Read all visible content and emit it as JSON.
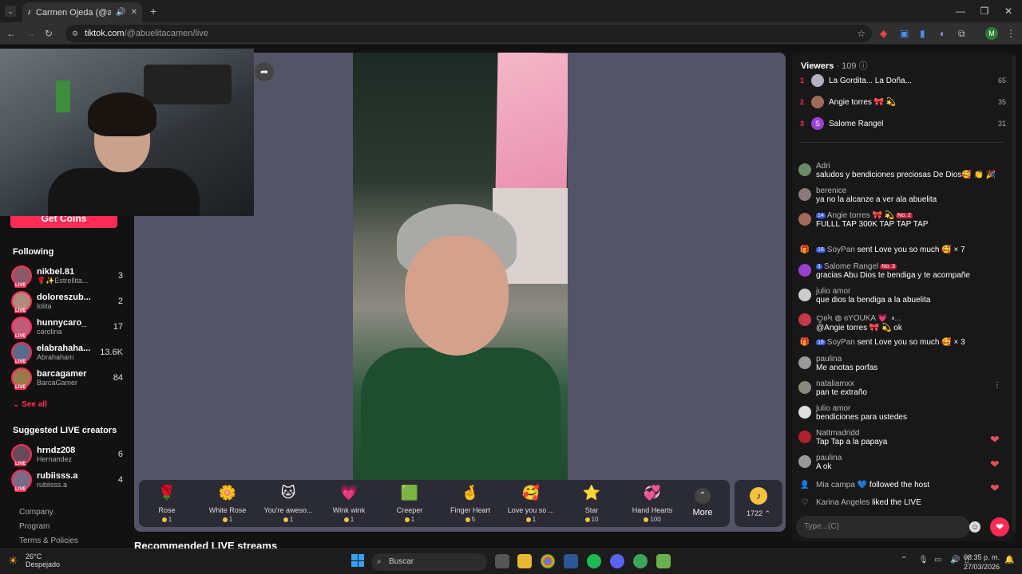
{
  "browser": {
    "tab_title": "Carmen Ojeda (@abuelitac",
    "url_domain": "tiktok.com",
    "url_path": "/@abuelitacamen/live",
    "profile_initial": "M"
  },
  "sidebar": {
    "get_coins": "Get Coins",
    "following_title": "Following",
    "following": [
      {
        "name": "nikbel.81",
        "sub": "🌹✨Estrellita...",
        "count": "3"
      },
      {
        "name": "doloreszub...",
        "sub": "lolita",
        "count": "2"
      },
      {
        "name": "hunnycaro_",
        "sub": "carolina",
        "count": "17"
      },
      {
        "name": "elabrahaha...",
        "sub": "Abrahaham",
        "count": "13.6K"
      },
      {
        "name": "barcagamer",
        "sub": "BarcaGamer",
        "count": "84"
      }
    ],
    "see_all": "See all",
    "suggested_title": "Suggested LIVE creators",
    "suggested": [
      {
        "name": "hrndz208",
        "sub": "Hernandez",
        "count": "6"
      },
      {
        "name": "rubiisss.a",
        "sub": "rubiisss.a",
        "count": "4"
      }
    ],
    "footer": [
      "Company",
      "Program",
      "Terms & Policies"
    ]
  },
  "gifts": [
    {
      "name": "Rose",
      "price": "1",
      "icon": "🌹"
    },
    {
      "name": "White Rose",
      "price": "1",
      "icon": "🌼"
    },
    {
      "name": "You're aweso...",
      "price": "1",
      "icon": "🐱"
    },
    {
      "name": "Wink wink",
      "price": "1",
      "icon": "💗"
    },
    {
      "name": "Creeper",
      "price": "1",
      "icon": "🟩"
    },
    {
      "name": "Finger Heart",
      "price": "5",
      "icon": "🤞"
    },
    {
      "name": "Love you so ...",
      "price": "1",
      "icon": "🥰"
    },
    {
      "name": "Star",
      "price": "10",
      "icon": "⭐"
    },
    {
      "name": "Hand Hearts",
      "price": "100",
      "icon": "💞"
    }
  ],
  "gift_more": "More",
  "coin_count": "1722",
  "recommended": "Recommended LIVE streams",
  "viewers": {
    "title": "Viewers",
    "count": "· 109",
    "top": [
      {
        "rank": "1",
        "name": "La Gordita... La Doña...",
        "score": "65"
      },
      {
        "rank": "2",
        "name": "Angie torres 🎀 💫",
        "score": "35"
      },
      {
        "rank": "3",
        "name": "Salome Rangel",
        "score": "31"
      }
    ]
  },
  "chat": [
    {
      "user": "Adri",
      "text": "saludos y bendiciones preciosas De Dios🥰 👏 🎉"
    },
    {
      "user": "berenice",
      "text": "ya no la alcanze a ver ala abuelita"
    },
    {
      "user": "Angie torres 🎀 💫",
      "badge": "14",
      "badge2": "No. 2",
      "text": "FULLL TAP 300K  TAP TAP TAP"
    },
    {
      "user": "SoyPan",
      "badge": "16",
      "text": "sent Love you so much 🥰 × 7",
      "system": true
    },
    {
      "user": "Salome Rangel",
      "badge": "1",
      "badge2": "No. 3",
      "text": "gracias Abu Dios te bendiga y te acompañe"
    },
    {
      "user": "julio amor",
      "text": "que dios la bendiga a la abuelita"
    },
    {
      "user": "ꨄ︎ʚϞ ◍ ɞYOUKA 💗 ◑...",
      "text": "@Angie torres 🎀 💫 ok"
    },
    {
      "user": "SoyPan",
      "badge": "16",
      "text": "sent Love you so much 🥰 × 3",
      "system": true
    },
    {
      "user": "paulina",
      "text": "Me anotas porfas"
    },
    {
      "user": "nataliamxx",
      "text": "pan te extraño"
    },
    {
      "user": "julio amor",
      "text": "bendiciones para ustedes"
    },
    {
      "user": "Nattmadridd",
      "text": "Tap Tap a la papaya"
    },
    {
      "user": "paulina",
      "text": "A ok"
    }
  ],
  "events": [
    {
      "user": "Mia campa",
      "text": "💙  followed the host"
    },
    {
      "user": "Karina Angeles",
      "text": "liked the LIVE"
    }
  ],
  "chat_placeholder": "Type...(C)",
  "taskbar": {
    "temp": "26°C",
    "weather": "Despejado",
    "search": "Buscar",
    "time": "08:35 p. m.",
    "date": "27/03/2026"
  }
}
